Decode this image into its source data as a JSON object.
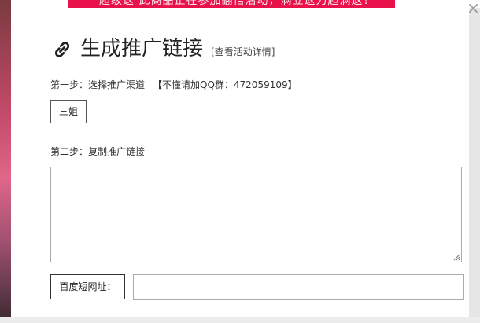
{
  "background": {
    "banner_text": "超级返 此商品正在参加翻倍活动，满立返力超满返！"
  },
  "modal": {
    "title": "生成推广链接",
    "activity_link": "[查看活动详情]",
    "close_symbol": "×",
    "step1": {
      "label": "第一步：选择推广渠道",
      "qq_note": "【不懂请加QQ群：472059109】",
      "channel_button": "三姐"
    },
    "step2": {
      "label": "第二步：复制推广链接",
      "link_value": ""
    },
    "short_url": {
      "label": "百度短网址：",
      "value": ""
    }
  },
  "colors": {
    "banner": "#e8114a",
    "text": "#222222",
    "border": "#aaaaaa"
  },
  "icons": {
    "title_icon": "link-icon",
    "close_icon": "close-icon"
  }
}
